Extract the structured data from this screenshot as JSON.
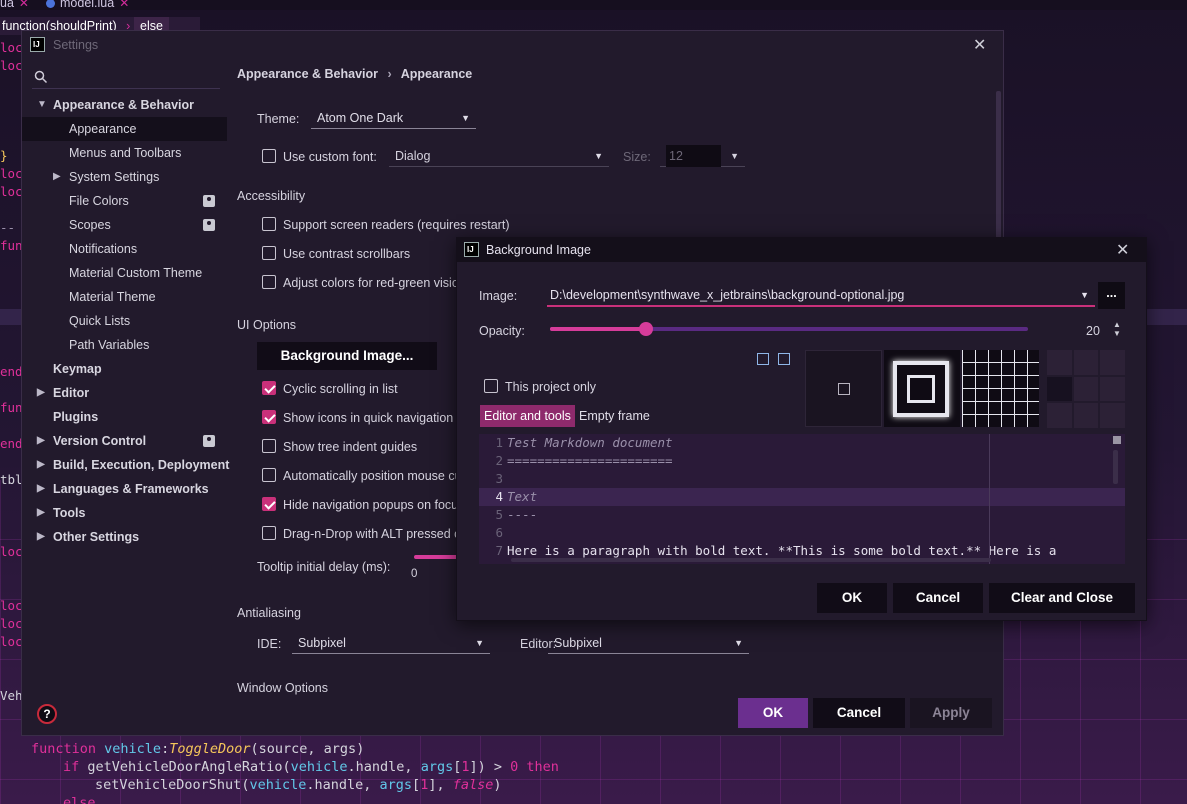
{
  "editor": {
    "tabs": [
      {
        "name": "ua"
      },
      {
        "name": "model.lua"
      }
    ],
    "breadcrumb": {
      "fn": "function(shouldPrint)",
      "sep": "›",
      "branch": "else"
    },
    "gutter_words": [
      "loc",
      "loc",
      "}",
      "loc",
      "loc",
      "--",
      "fun",
      "end",
      "fun",
      "end",
      "tbl",
      "loc",
      "loc",
      "loc",
      "loc",
      "Veh"
    ],
    "code": {
      "line1": {
        "kw": "function ",
        "obj": "vehicle",
        "colon": ":",
        "method": "ToggleDoor",
        "open": "(",
        "p1": "source",
        "comma": ", ",
        "p2": "args",
        "close": ")"
      },
      "line2": {
        "kw": "if ",
        "fn": "getVehicleDoorAngleRatio",
        "open": "(",
        "obj": "vehicle",
        "prop": ".handle",
        "comma": ", ",
        "args": "args",
        "idx_open": "[",
        "idx": "1",
        "idx_close": "]",
        "rest": ") > ",
        "num": "0",
        "then": " then"
      },
      "line3": {
        "fn": "setVehicleDoorShut",
        "open": "(",
        "obj": "vehicle",
        "prop": ".handle",
        "comma": ", ",
        "args": "args",
        "idx_open": "[",
        "idx": "1",
        "idx_close": "]",
        "comma2": ", ",
        "bool": "false",
        "close": ")"
      },
      "line4": {
        "kw": "else"
      }
    }
  },
  "settings": {
    "title": "Settings",
    "breadcrumb": {
      "parent": "Appearance & Behavior",
      "sep": "›",
      "current": "Appearance"
    },
    "sidebar": [
      {
        "label": "Appearance & Behavior"
      },
      {
        "label": "Appearance"
      },
      {
        "label": "Menus and Toolbars"
      },
      {
        "label": "System Settings"
      },
      {
        "label": "File Colors"
      },
      {
        "label": "Scopes"
      },
      {
        "label": "Notifications"
      },
      {
        "label": "Material Custom Theme"
      },
      {
        "label": "Material Theme"
      },
      {
        "label": "Quick Lists"
      },
      {
        "label": "Path Variables"
      },
      {
        "label": "Keymap"
      },
      {
        "label": "Editor"
      },
      {
        "label": "Plugins"
      },
      {
        "label": "Version Control"
      },
      {
        "label": "Build, Execution, Deployment"
      },
      {
        "label": "Languages & Frameworks"
      },
      {
        "label": "Tools"
      },
      {
        "label": "Other Settings"
      }
    ],
    "theme_label": "Theme:",
    "theme_value": "Atom One Dark",
    "custom_font_label": "Use custom font:",
    "font_value": "Dialog",
    "size_label": "Size:",
    "size_value": "12",
    "accessibility_header": "Accessibility",
    "acc_items": [
      {
        "label": "Support screen readers (requires restart)",
        "checked": false
      },
      {
        "label": "Use contrast scrollbars",
        "checked": false
      },
      {
        "label": "Adjust colors for red-green visio",
        "checked": false
      }
    ],
    "ui_options_header": "UI Options",
    "bg_image_button": "Background Image...",
    "ui_items": [
      {
        "label": "Cyclic scrolling in list",
        "checked": true
      },
      {
        "label": "Show icons in quick navigation",
        "checked": true
      },
      {
        "label": "Show tree indent guides",
        "checked": false
      },
      {
        "label": "Automatically position mouse cu",
        "checked": false
      },
      {
        "label": "Hide navigation popups on focu",
        "checked": true
      },
      {
        "label": "Drag-n-Drop with ALT pressed c",
        "checked": false
      }
    ],
    "tooltip_label": "Tooltip initial delay (ms):",
    "tooltip_min": "0",
    "antialiasing_header": "Antialiasing",
    "ide_label": "IDE:",
    "ide_value": "Subpixel",
    "editor_label": "Editor:",
    "editor_value": "Subpixel",
    "window_options_header": "Window Options",
    "ok": "OK",
    "cancel": "Cancel",
    "apply": "Apply",
    "help_icon": "?"
  },
  "bg_dialog": {
    "title": "Background Image",
    "image_label": "Image:",
    "image_path": "D:\\development\\synthwave_x_jetbrains\\background-optional.jpg",
    "browse": "...",
    "opacity_label": "Opacity:",
    "opacity_value": "20",
    "opacity_fraction": 0.2,
    "this_project_only": "This project only",
    "tabs": [
      "Editor and tools",
      "Empty frame"
    ],
    "preview_lines": [
      {
        "n": "1",
        "text": "Test Markdown document"
      },
      {
        "n": "2",
        "text": "======================"
      },
      {
        "n": "3",
        "text": ""
      },
      {
        "n": "4",
        "text": "Text"
      },
      {
        "n": "5",
        "text": "----"
      },
      {
        "n": "6",
        "text": ""
      },
      {
        "n": "7",
        "text": "Here is a paragraph with bold text. **This is some bold text.** Here is a"
      }
    ],
    "ok": "OK",
    "cancel": "Cancel",
    "clear_close": "Clear and Close"
  },
  "colors": {
    "accent": "#c9307a",
    "primary_button": "#6b2f8f",
    "keyword": "#e0309a",
    "method": "#f6c75a",
    "string_var": "#62c8e8"
  }
}
